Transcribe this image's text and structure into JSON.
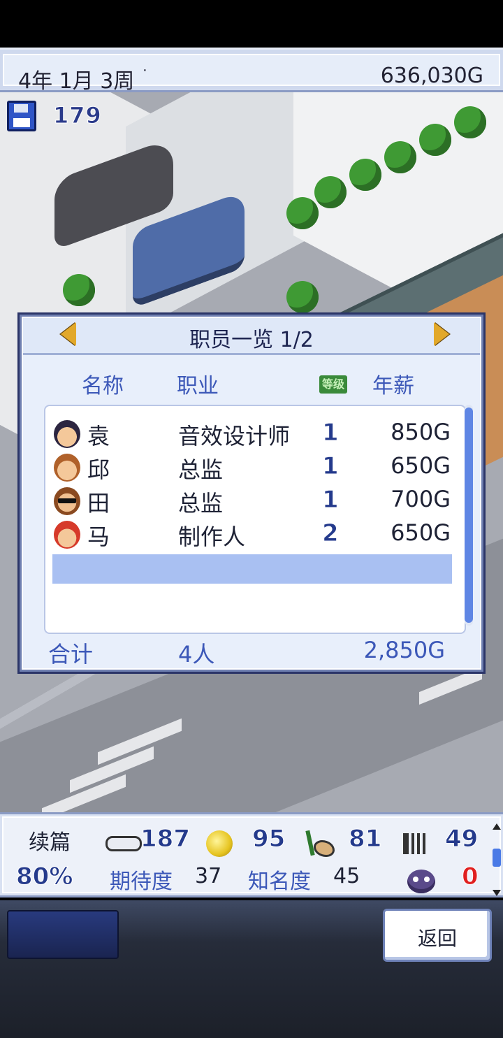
{
  "header": {
    "date": "4年 1月 3周",
    "date_dot": "˙",
    "money": "636,030G"
  },
  "save": {
    "icon": "floppy-disk-icon",
    "count": "179"
  },
  "staff_panel": {
    "title": "职员一览 1/2",
    "columns": {
      "name": "名称",
      "job": "职业",
      "level": "等级",
      "salary": "年薪"
    },
    "rows": [
      {
        "name": "袁",
        "job": "音效设计师",
        "level": "1",
        "salary": "850G"
      },
      {
        "name": "邱",
        "job": "总监",
        "level": "1",
        "salary": "650G"
      },
      {
        "name": "田",
        "job": "总监",
        "level": "1",
        "salary": "700G"
      },
      {
        "name": "马",
        "job": "制作人",
        "level": "2",
        "salary": "650G"
      }
    ],
    "total": {
      "label": "合计",
      "count": "4人",
      "salary": "2,850G"
    }
  },
  "status": {
    "game_type": "续篇",
    "progress": "80%",
    "fun": "187",
    "creativity": "95",
    "graphics": "81",
    "sound": "49",
    "expectation_label": "期待度",
    "expectation": "37",
    "fame_label": "知名度",
    "fame": "45",
    "bugs": "0"
  },
  "nav": {
    "back_label": "返回"
  },
  "colors": {
    "accent_blue": "#3c58b8",
    "panel_bg": "#e8effb",
    "selection": "#a9c0f2",
    "bug_red": "#e02020"
  }
}
